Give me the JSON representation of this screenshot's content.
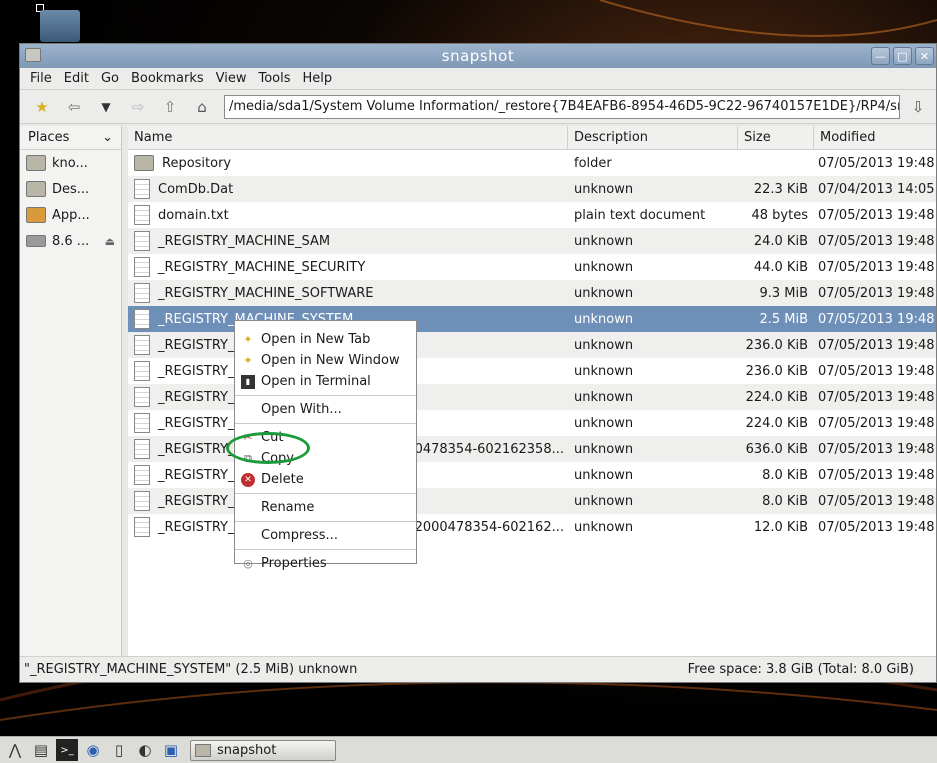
{
  "window": {
    "title": "snapshot",
    "controls": [
      "—",
      "□",
      "✕"
    ]
  },
  "menubar": {
    "items": [
      {
        "label": "File"
      },
      {
        "label": "Edit"
      },
      {
        "label": "Go"
      },
      {
        "label": "Bookmarks"
      },
      {
        "label": "View"
      },
      {
        "label": "Tools"
      },
      {
        "label": "Help"
      }
    ]
  },
  "toolbar": {
    "path": "/media/sda1/System Volume Information/_restore{7B4EAFB6-8954-46D5-9C22-96740157E1DE}/RP4/sna"
  },
  "places": {
    "header": "Places",
    "items": [
      {
        "label": "kno..."
      },
      {
        "label": "Des..."
      },
      {
        "label": "App..."
      },
      {
        "label": "8.6 ..."
      }
    ]
  },
  "columns": {
    "name": "Name",
    "description": "Description",
    "size": "Size",
    "modified": "Modified"
  },
  "files": [
    {
      "name": "Repository",
      "desc": "folder",
      "size": "",
      "mod": "07/05/2013 19:48"
    },
    {
      "name": "ComDb.Dat",
      "desc": "unknown",
      "size": "22.3 KiB",
      "mod": "07/04/2013 14:05"
    },
    {
      "name": "domain.txt",
      "desc": "plain text document",
      "size": "48 bytes",
      "mod": "07/05/2013 19:48"
    },
    {
      "name": "_REGISTRY_MACHINE_SAM",
      "desc": "unknown",
      "size": "24.0 KiB",
      "mod": "07/05/2013 19:48"
    },
    {
      "name": "_REGISTRY_MACHINE_SECURITY",
      "desc": "unknown",
      "size": "44.0 KiB",
      "mod": "07/05/2013 19:48"
    },
    {
      "name": "_REGISTRY_MACHINE_SOFTWARE",
      "desc": "unknown",
      "size": "9.3 MiB",
      "mod": "07/05/2013 19:48"
    },
    {
      "name": "_REGISTRY_MACHINE_SYSTEM",
      "desc": "unknown",
      "size": "2.5 MiB",
      "mod": "07/05/2013 19:48"
    },
    {
      "name": "_REGISTRY_U",
      "desc": "unknown",
      "size": "236.0 KiB",
      "mod": "07/05/2013 19:48"
    },
    {
      "name": "_REGISTRY_U",
      "desc": "unknown",
      "size": "236.0 KiB",
      "mod": "07/05/2013 19:48"
    },
    {
      "name": "_REGISTRY_U",
      "desc": "unknown",
      "size": "224.0 KiB",
      "mod": "07/05/2013 19:48"
    },
    {
      "name": "_REGISTRY_U",
      "desc": "unknown",
      "size": "224.0 KiB",
      "mod": "07/05/2013 19:48"
    },
    {
      "name": "_REGISTRY_U",
      "tail": "0478354-602162358...",
      "desc": "unknown",
      "size": "636.0 KiB",
      "mod": "07/05/2013 19:48"
    },
    {
      "name": "_REGISTRY_U",
      "desc": "unknown",
      "size": "8.0 KiB",
      "mod": "07/05/2013 19:48"
    },
    {
      "name": "_REGISTRY_U",
      "desc": "unknown",
      "size": "8.0 KiB",
      "mod": "07/05/2013 19:48"
    },
    {
      "name": "_REGISTRY_U",
      "tail": "2000478354-602162...",
      "desc": "unknown",
      "size": "12.0 KiB",
      "mod": "07/05/2013 19:48"
    }
  ],
  "context_menu": {
    "items": [
      {
        "label": "Open in New Tab",
        "icon": "new-tab-icon"
      },
      {
        "label": "Open in New Window",
        "icon": "new-window-icon"
      },
      {
        "label": "Open in Terminal",
        "icon": "terminal-icon"
      },
      {
        "label": "Open With...",
        "icon": ""
      },
      {
        "label": "Cut",
        "icon": "scissors-icon"
      },
      {
        "label": "Copy",
        "icon": "copy-icon"
      },
      {
        "label": "Delete",
        "icon": "delete-icon"
      },
      {
        "label": "Rename",
        "icon": ""
      },
      {
        "label": "Compress...",
        "icon": ""
      },
      {
        "label": "Properties",
        "icon": "properties-icon"
      }
    ]
  },
  "statusbar": {
    "left": "\"_REGISTRY_MACHINE_SYSTEM\" (2.5 MiB) unknown",
    "right": "Free space: 3.8 GiB (Total: 8.0 GiB)"
  },
  "taskbar": {
    "task_label": "snapshot"
  },
  "colors": {
    "selection": "#6e8fb8",
    "titlebar": "#8aa3bf",
    "highlight_ring": "#1d9a3a"
  }
}
